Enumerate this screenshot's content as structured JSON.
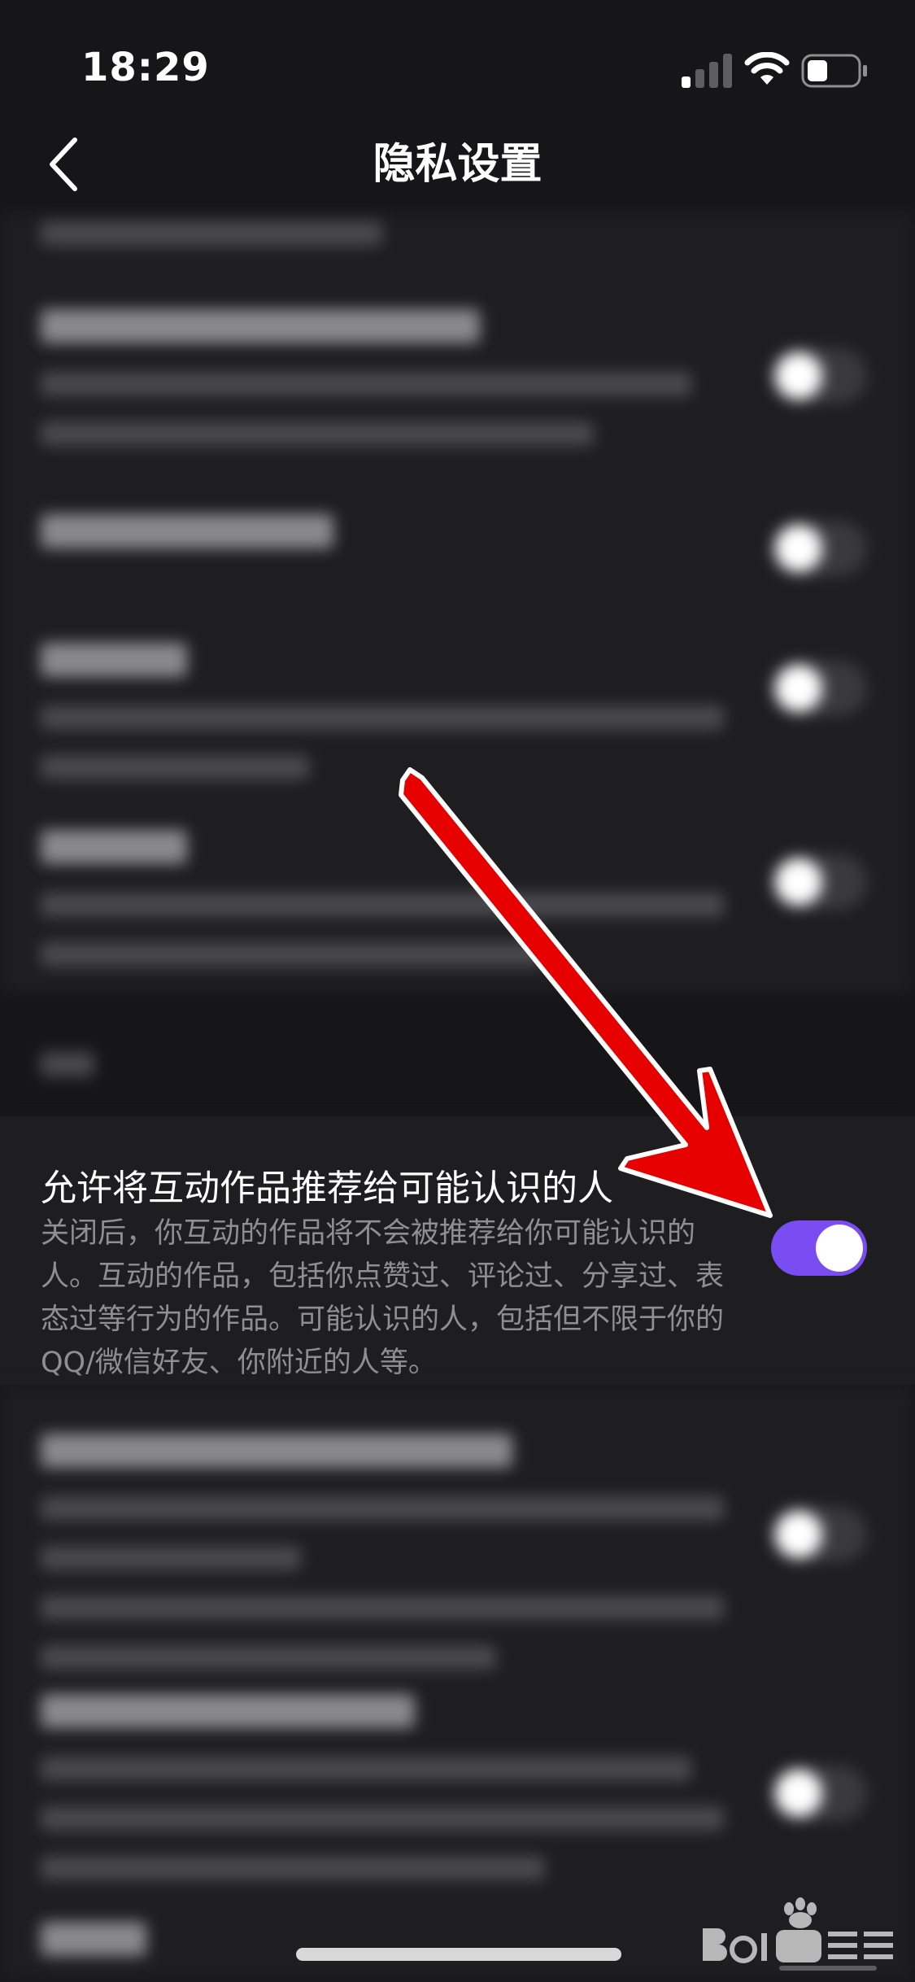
{
  "status_bar": {
    "time": "18:29"
  },
  "header": {
    "title": "隐私设置"
  },
  "focus_setting": {
    "title": "允许将互动作品推荐给可能认识的人",
    "description": "关闭后，你互动的作品将不会被推荐给你可能认识的人。互动的作品，包括你点赞过、评论过、分享过、表态过等行为的作品。可能认识的人，包括但不限于你的 QQ/微信好友、你附近的人等。",
    "enabled": true
  },
  "colors": {
    "toggle_on": "#7a4df2",
    "annotation_arrow": "#e60000",
    "background": "#161618"
  },
  "icons": {
    "back": "back-icon",
    "signal": "signal-icon",
    "wifi": "wifi-icon",
    "battery": "battery-icon"
  }
}
